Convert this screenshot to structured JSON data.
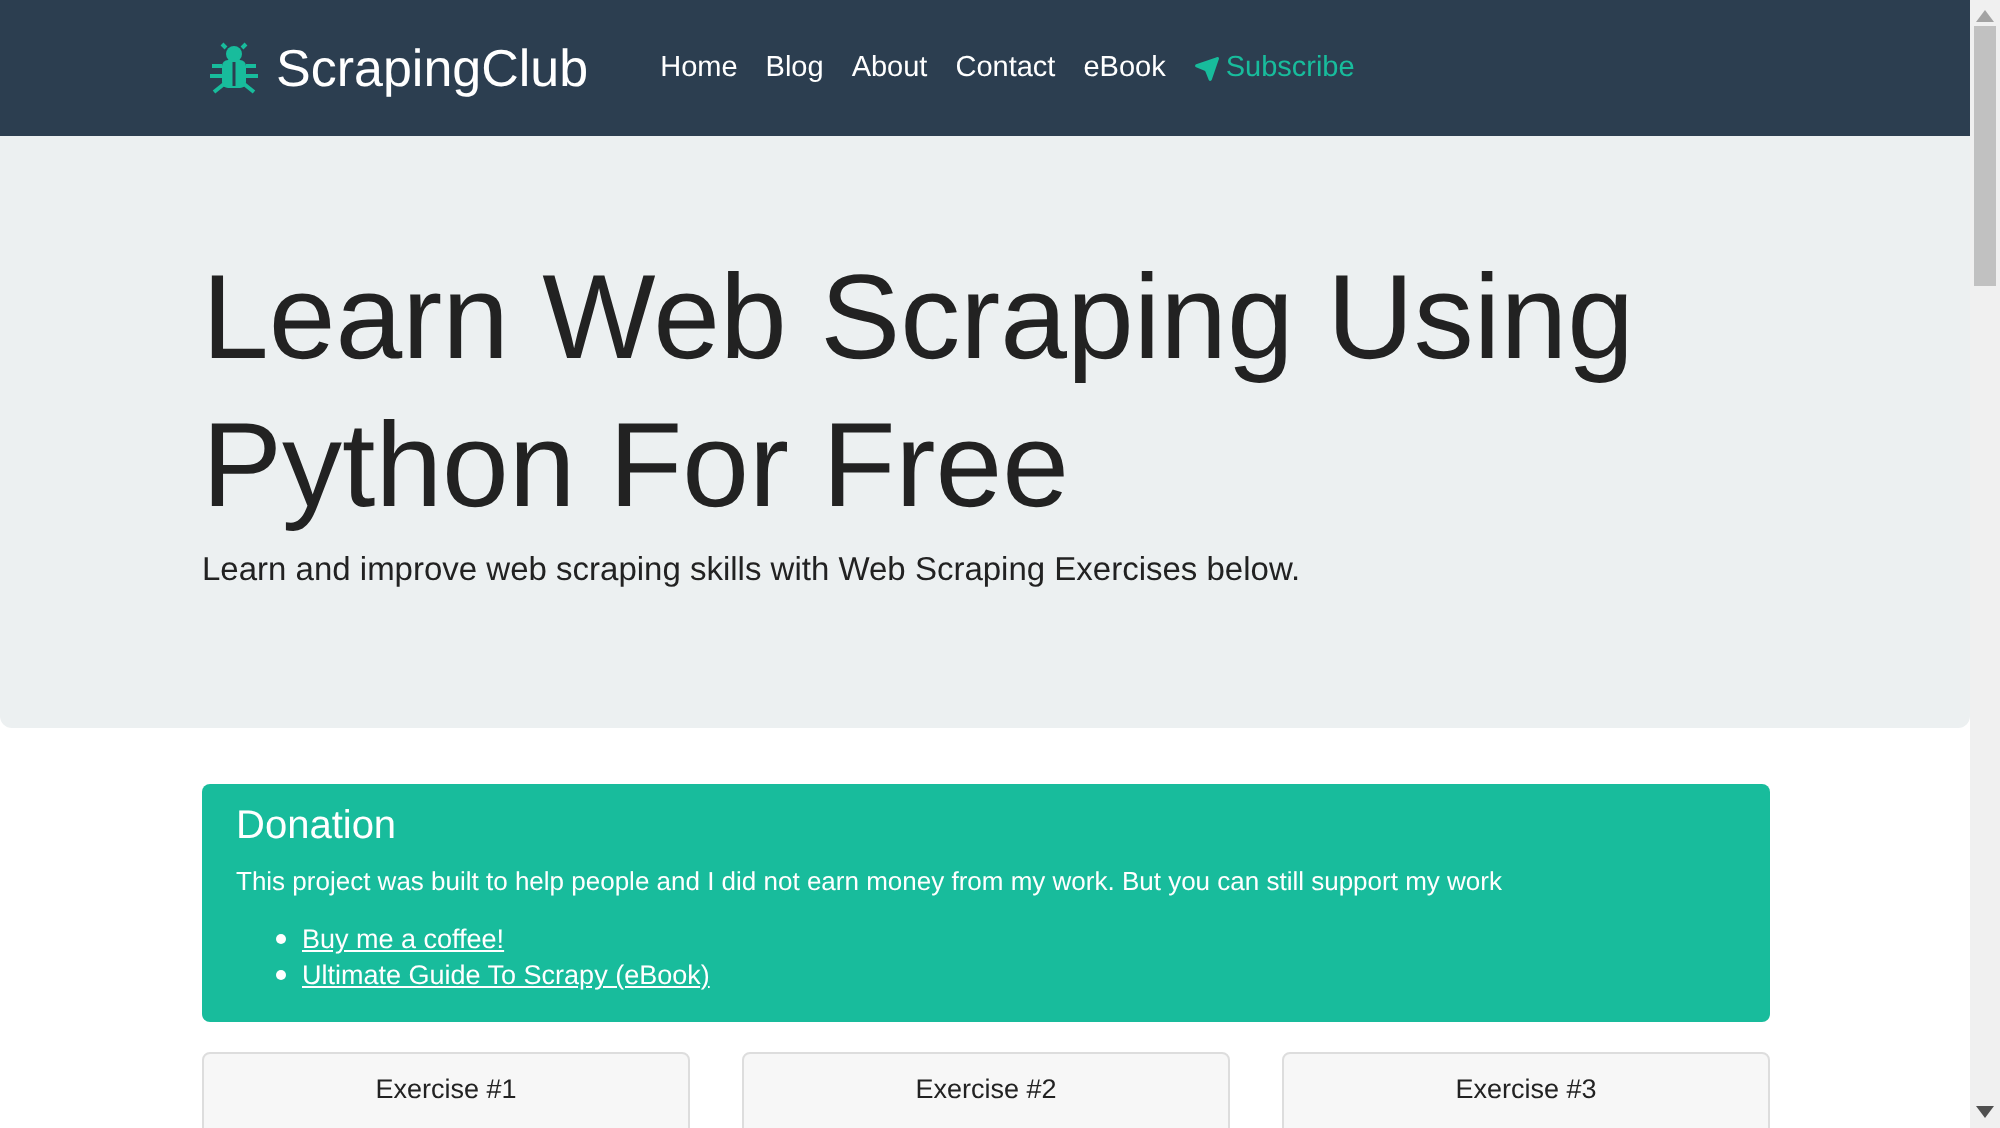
{
  "navbar": {
    "brand": "ScrapingClub",
    "links": [
      {
        "label": "Home",
        "kind": "plain"
      },
      {
        "label": "Blog",
        "kind": "plain"
      },
      {
        "label": "About",
        "kind": "plain"
      },
      {
        "label": "Contact",
        "kind": "plain"
      },
      {
        "label": "eBook",
        "kind": "plain"
      },
      {
        "label": "Subscribe",
        "kind": "subscribe"
      }
    ]
  },
  "hero": {
    "title": "Learn Web Scraping Using Python For Free",
    "subtitle": "Learn and improve web scraping skills with Web Scraping Exercises below."
  },
  "donation": {
    "heading": "Donation",
    "text": "This project was built to help people and I did not earn money from my work. But you can still support my work",
    "links": [
      "Buy me a coffee!",
      "Ultimate Guide To Scrapy (eBook)"
    ]
  },
  "exercises": [
    {
      "title": "Exercise #1"
    },
    {
      "title": "Exercise #2"
    },
    {
      "title": "Exercise #3"
    }
  ]
}
